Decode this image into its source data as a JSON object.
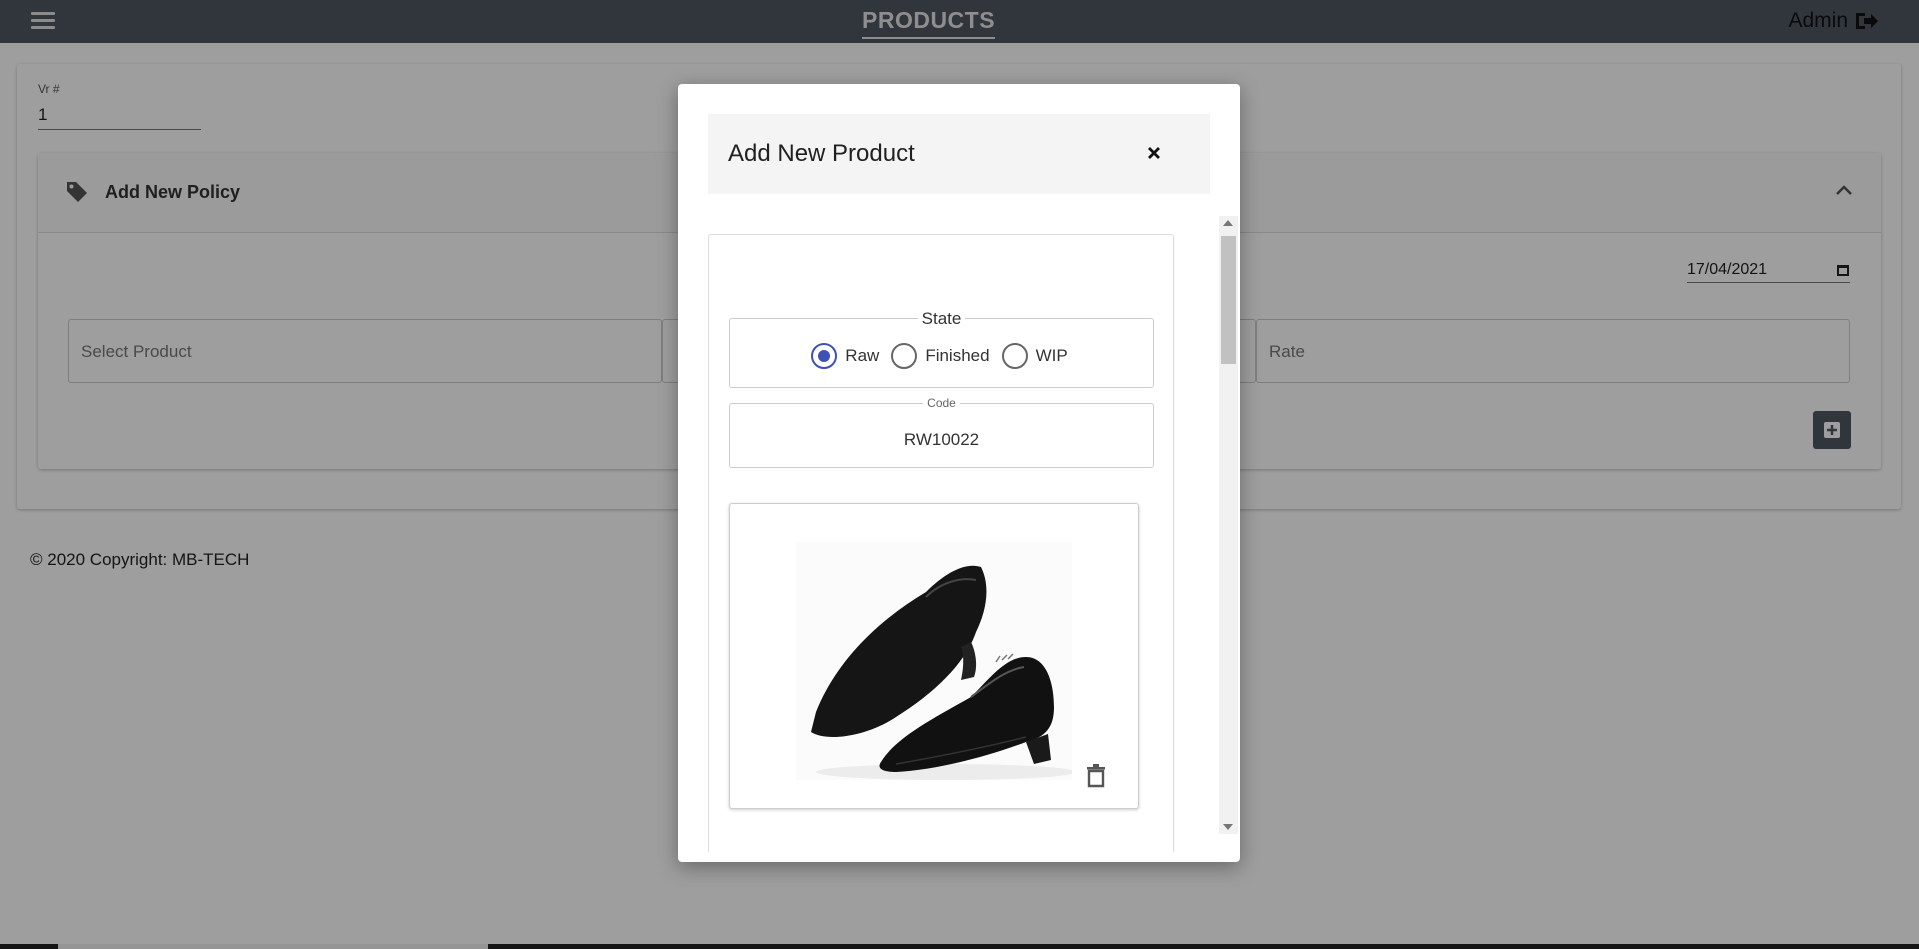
{
  "navbar": {
    "title": "PRODUCTS",
    "user": "Admin",
    "bg_color": "#4f5763"
  },
  "form": {
    "vr_label": "Vr #",
    "vr_value": "1"
  },
  "policy": {
    "title": "Add New Policy",
    "date": "17/04/2021",
    "product_placeholder": "Select Product",
    "middle_placeholder": "",
    "rate_placeholder": "Rate"
  },
  "footer": {
    "copyright": "© 2020 Copyright: MB-TECH"
  },
  "modal": {
    "title": "Add New Product",
    "state_label": "State",
    "states": [
      {
        "label": "Raw",
        "checked": true
      },
      {
        "label": "Finished",
        "checked": false
      },
      {
        "label": "WIP",
        "checked": false
      }
    ],
    "code_label": "Code",
    "code_value": "RW10022",
    "accent_color": "#3f51b5"
  },
  "icons": [
    "menu-icon",
    "logout-icon",
    "tag-icon",
    "chevron-up-icon",
    "calendar-icon",
    "plus-square-icon",
    "close-icon",
    "trash-icon"
  ]
}
